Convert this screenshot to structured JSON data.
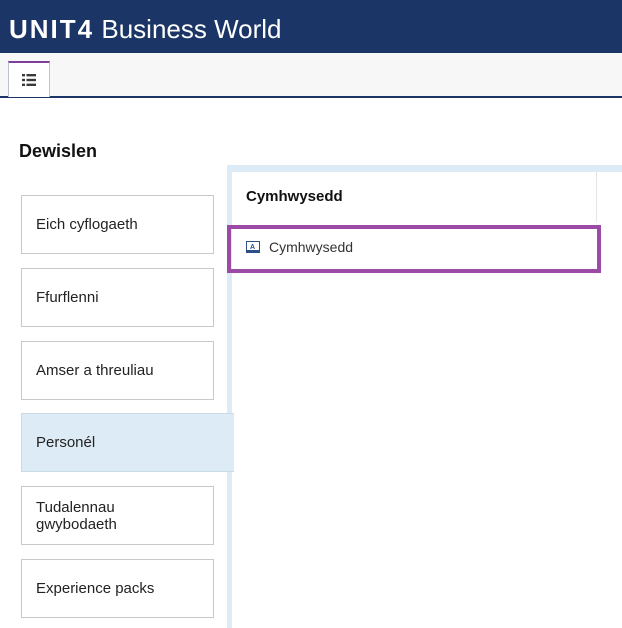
{
  "header": {
    "brand_logo": "UNIT4",
    "brand_product": "Business World",
    "bg_color": "#1a3566"
  },
  "tabs": {
    "menu_tab_icon": "list-icon"
  },
  "menu": {
    "title": "Dewislen",
    "items": [
      {
        "label": "Eich cyflogaeth",
        "active": false
      },
      {
        "label": "Ffurflenni",
        "active": false
      },
      {
        "label": "Amser a threuliau",
        "active": false
      },
      {
        "label": "Personél",
        "active": true
      },
      {
        "label": "Tudalennau gwybodaeth",
        "active": false
      },
      {
        "label": "Experience packs",
        "active": false
      }
    ]
  },
  "panel": {
    "section_title": "Cymhwysedd",
    "items": [
      {
        "label": "Cymhwysedd",
        "icon": "form-icon"
      }
    ],
    "highlight_color": "#9b4ba5"
  }
}
